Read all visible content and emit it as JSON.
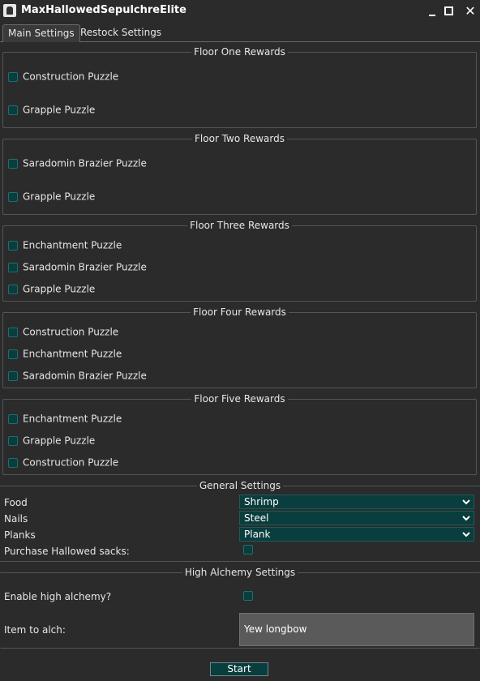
{
  "window": {
    "title": "MaxHallowedSepulchreElite",
    "minimize_glyph": "",
    "maximize_glyph": "",
    "close_glyph": "✕"
  },
  "tabs": [
    {
      "label": "Main Settings",
      "active": true
    },
    {
      "label": "Restock Settings",
      "active": false
    }
  ],
  "floors": [
    {
      "title": "Floor One Rewards",
      "items": [
        "Construction Puzzle",
        "Grapple Puzzle"
      ]
    },
    {
      "title": "Floor Two Rewards",
      "items": [
        "Saradomin Brazier Puzzle",
        "Grapple Puzzle"
      ]
    },
    {
      "title": "Floor Three Rewards",
      "items": [
        "Enchantment Puzzle",
        "Saradomin Brazier Puzzle",
        "Grapple Puzzle"
      ]
    },
    {
      "title": "Floor Four Rewards",
      "items": [
        "Construction Puzzle",
        "Enchantment Puzzle",
        "Saradomin Brazier Puzzle"
      ]
    },
    {
      "title": "Floor Five Rewards",
      "items": [
        "Enchantment Puzzle",
        "Grapple Puzzle",
        "Construction Puzzle"
      ]
    }
  ],
  "general": {
    "title": "General Settings",
    "food_label": "Food",
    "food_value": "Shrimp",
    "nails_label": "Nails",
    "nails_value": "Steel",
    "planks_label": "Planks",
    "planks_value": "Plank",
    "sacks_label": "Purchase Hallowed sacks:"
  },
  "alchemy": {
    "title": "High Alchemy Settings",
    "enable_label": "Enable high alchemy?",
    "item_label": "Item to alch:",
    "item_value": "Yew longbow"
  },
  "start_label": "Start",
  "colors": {
    "background": "#2b2b2b",
    "accent": "#0a3d3d",
    "text": "#e6e6e6",
    "border": "#555555"
  }
}
